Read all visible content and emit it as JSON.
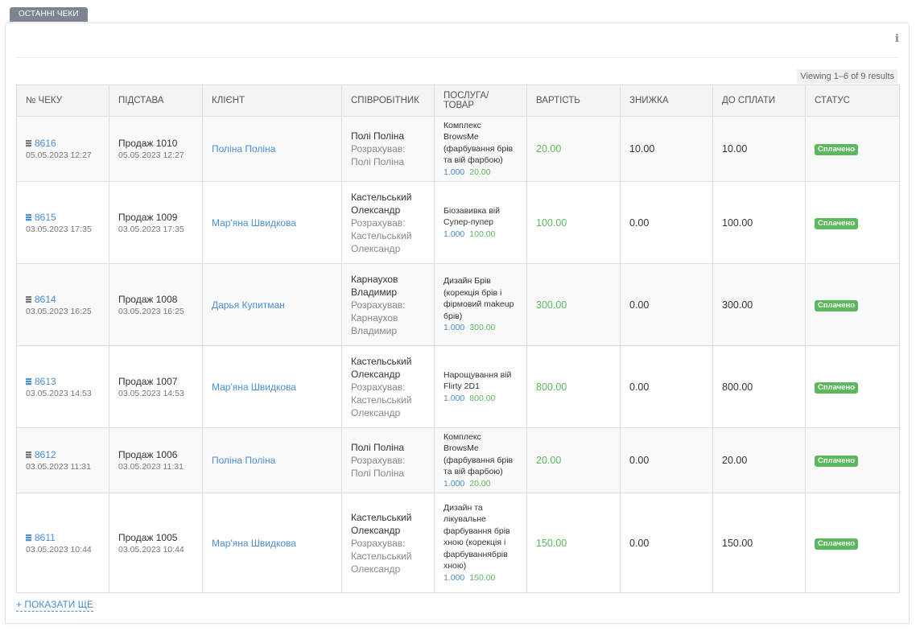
{
  "tab_label": "ОСТАННІ ЧЕКИ",
  "info_icon": "i",
  "viewing": "Viewing 1–6 of 9 results",
  "columns": [
    "№ ЧЕКУ",
    "ПІДСТАВА",
    "КЛІЄНТ",
    "СПІВРОБІТНИК",
    "ПОСЛУГА/ТОВАР",
    "ВАРТІСТЬ",
    "ЗНИЖКА",
    "ДО СПЛАТИ",
    "СТАТУС"
  ],
  "rows": [
    {
      "check": "8616",
      "check_date": "05.05.2023 12:27",
      "icon": "grey",
      "basis": "Продаж 1010",
      "basis_date": "05.05.2023 12:27",
      "client": "Поліна Поліна",
      "employee": "Полі Поліна",
      "role": "Розрахував: Полі Поліна",
      "service": "Комплекс BrowsMe (фарбування брів та вій фарбою)",
      "qty": "1.000",
      "service_price": "20.00",
      "cost": "20.00",
      "discount": "10.00",
      "to_pay": "10.00",
      "status": "Сплачено",
      "height": 81
    },
    {
      "check": "8615",
      "check_date": "03.05.2023 17:35",
      "icon": "blue",
      "basis": "Продаж 1009",
      "basis_date": "03.05.2023 17:35",
      "client": "Мар'яна Швидкова",
      "employee": "Кастельський Олександр",
      "role": "Розрахував: Кастельський Олександр",
      "service": "Біозавивка вій Супер-пупер",
      "qty": "1.000",
      "service_price": "100.00",
      "cost": "100.00",
      "discount": "0.00",
      "to_pay": "100.00",
      "status": "Сплачено",
      "height": 102
    },
    {
      "check": "8614",
      "check_date": "03.05.2023 16:25",
      "icon": "grey",
      "basis": "Продаж 1008",
      "basis_date": "03.05.2023 16:25",
      "client": "Дарья Купитман",
      "employee": "Карнаухов Владимир",
      "role": "Розрахував: Карнаухов Владимир",
      "service": "Дизайн Брів (корекція брів і фірмовий makeup брів)",
      "qty": "1.000",
      "service_price": "300.00",
      "cost": "300.00",
      "discount": "0.00",
      "to_pay": "300.00",
      "status": "Сплачено",
      "height": 102
    },
    {
      "check": "8613",
      "check_date": "03.05.2023 14:53",
      "icon": "blue",
      "basis": "Продаж 1007",
      "basis_date": "03.05.2023 14:53",
      "client": "Мар'яна Швидкова",
      "employee": "Кастельський Олександр",
      "role": "Розрахував: Кастельський Олександр",
      "service": "Нарощування вій Flirty 2D1",
      "qty": "1.000",
      "service_price": "800.00",
      "cost": "800.00",
      "discount": "0.00",
      "to_pay": "800.00",
      "status": "Сплачено",
      "height": 102
    },
    {
      "check": "8612",
      "check_date": "03.05.2023 11:31",
      "icon": "grey",
      "basis": "Продаж 1006",
      "basis_date": "03.05.2023 11:31",
      "client": "Поліна Поліна",
      "employee": "Полі Поліна",
      "role": "Розрахував: Полі Поліна",
      "service": "Комплекс BrowsMe (фарбування брів та вій фарбою)",
      "qty": "1.000",
      "service_price": "20.00",
      "cost": "20.00",
      "discount": "0.00",
      "to_pay": "20.00",
      "status": "Сплачено",
      "height": 81
    },
    {
      "check": "8611",
      "check_date": "03.05.2023 10:44",
      "icon": "blue",
      "basis": "Продаж 1005",
      "basis_date": "03.05.2023 10:44",
      "client": "Мар'яна Швидкова",
      "employee": "Кастельський Олександр",
      "role": "Розрахував: Кастельський Олександр",
      "service": "Дизайн та лікувальне фарбування брів хною (корекція і фарбуваннябрів хною)",
      "qty": "1.000",
      "service_price": "150.00",
      "cost": "150.00",
      "discount": "0.00",
      "to_pay": "150.00",
      "status": "Сплачено",
      "height": 124
    }
  ],
  "show_more": "+ ПОКАЗАТИ ЩЕ",
  "colors": {
    "link": "#4a8ed6",
    "green": "#5cb85c",
    "tab": "#7c8591"
  },
  "icons": {
    "doc": "document-icon",
    "info": "info-icon"
  }
}
